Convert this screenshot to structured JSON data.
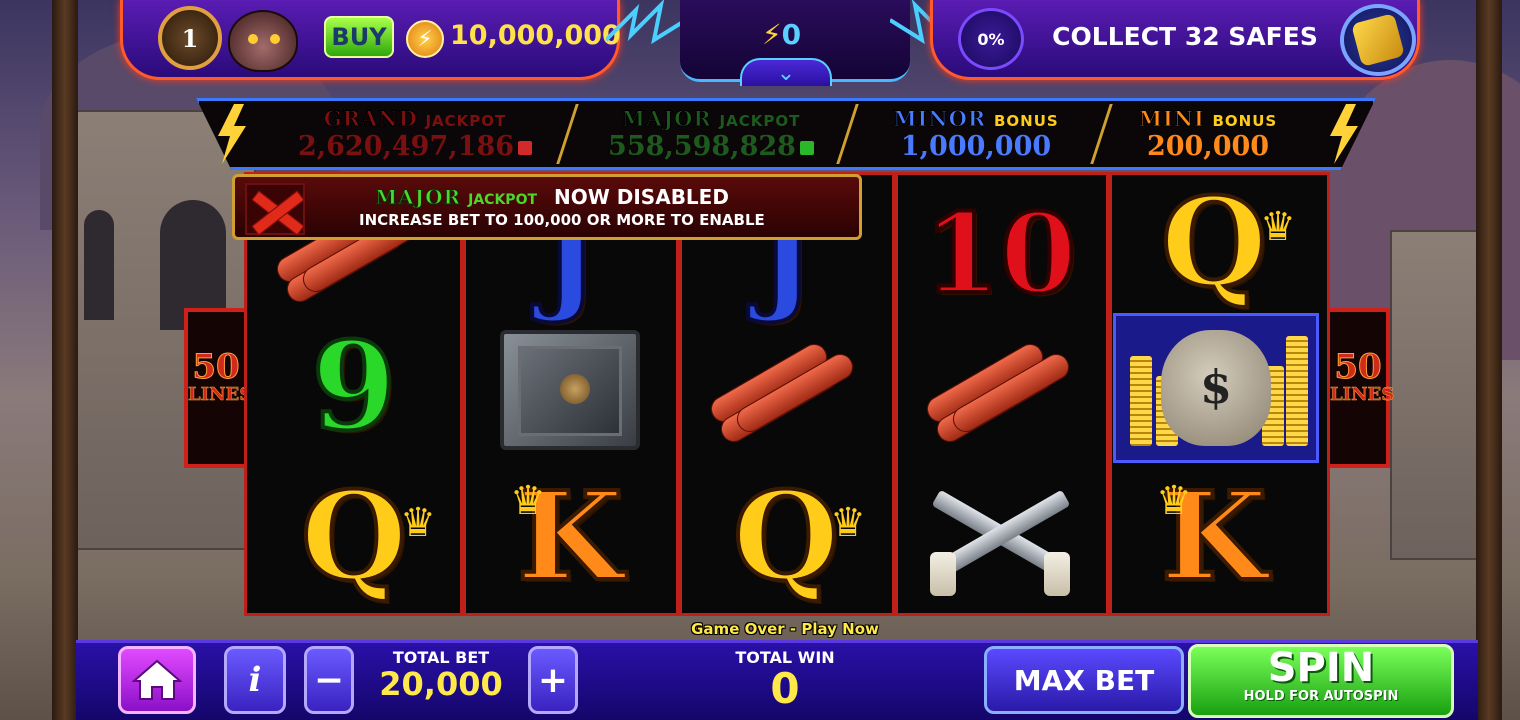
{
  "top": {
    "level": "1",
    "buy_label": "BUY",
    "coins": "10,000,000",
    "bolts": "0",
    "progress_pct": "0%",
    "quest": "COLLECT 32 SAFES"
  },
  "jackpots": {
    "grand": {
      "word": "GRAND",
      "kind": "JACKPOT",
      "value": "2,620,497,186",
      "color": "#7a1010"
    },
    "major": {
      "word": "MAJOR",
      "kind": "JACKPOT",
      "value": "558,598,828",
      "color": "#1e5a1e"
    },
    "minor": {
      "word": "MINOR",
      "kind": "BONUS",
      "value": "1,000,000",
      "color": "#4a7aff"
    },
    "mini": {
      "word": "MINI",
      "kind": "BONUS",
      "value": "200,000",
      "color": "#ff8a1a"
    }
  },
  "banner": {
    "word": "MAJOR",
    "kind": "JACKPOT",
    "status": "NOW DISABLED",
    "hint": "INCREASE BET TO 100,000 OR MORE TO ENABLE"
  },
  "lines_left": {
    "n": "50",
    "l": "LINES"
  },
  "lines_right": {
    "n": "50",
    "l": "LINES"
  },
  "reels": {
    "r1": [
      "dynamite",
      "9",
      "Q"
    ],
    "r2": [
      "J",
      "safe",
      "K"
    ],
    "r3": [
      "J",
      "dynamite",
      "Q"
    ],
    "r4": [
      "10",
      "dynamite",
      "revolvers"
    ],
    "r5": [
      "Q",
      "money-bag",
      "K"
    ],
    "sym9": "9",
    "sym10": "10",
    "symQ": "Q",
    "symK": "K",
    "symJ": "J",
    "dollar": "$"
  },
  "status_text": "Game Over - Play Now",
  "bottom": {
    "total_bet_label": "TOTAL BET",
    "total_bet": "20,000",
    "total_win_label": "TOTAL WIN",
    "total_win": "0",
    "minus": "−",
    "plus": "+",
    "info": "i",
    "max_bet": "MAX BET",
    "spin": "SPIN",
    "spin_sub": "HOLD FOR AUTOSPIN"
  }
}
